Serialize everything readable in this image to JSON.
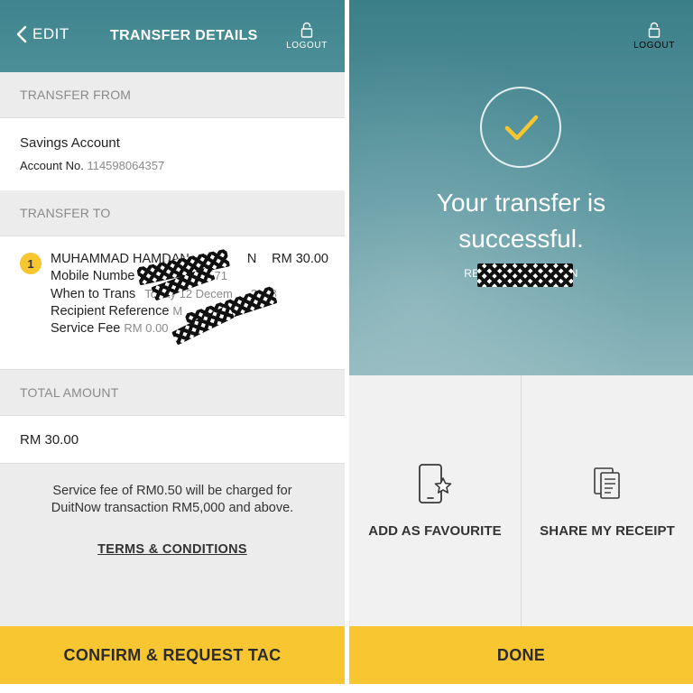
{
  "left": {
    "header": {
      "back_label": "EDIT",
      "title": "TRANSFER DETAILS",
      "logout_label": "LOGOUT"
    },
    "transfer_from": {
      "section_label": "TRANSFER FROM",
      "account_name": "Savings Account",
      "account_no_label": "Account No.",
      "account_no_value": "114598064357"
    },
    "transfer_to": {
      "section_label": "TRANSFER TO",
      "badge": "1",
      "recipient_name": "MUHAMMAD HAMDAN",
      "recipient_name_tail": "N",
      "amount": "RM 30.00",
      "mobile_label": "Mobile Numbe",
      "mobile_tail": "71",
      "when_label": "When to Trans",
      "when_value": "Today 12 Decem",
      "when_tail": "2018",
      "reference_label": "Recipient Reference",
      "reference_value": "M",
      "fee_label": "Service Fee",
      "fee_value": "RM 0.00"
    },
    "total": {
      "section_label": "TOTAL AMOUNT",
      "value": "RM 30.00"
    },
    "note_line1": "Service fee of RM0.50 will be charged for",
    "note_line2": "DuitNow transaction RM5,000 and above.",
    "terms_label": "TERMS & CONDITIONS",
    "cta_label": "CONFIRM & REQUEST TAC"
  },
  "right": {
    "logout_label": "LOGOUT",
    "success_line1": "Your transfer is",
    "success_line2": "successful.",
    "ref_prefix": "RE",
    "ref_suffix": "N",
    "actions": [
      {
        "label": "ADD AS FAVOURITE",
        "icon": "phone-star-icon"
      },
      {
        "label": "SHARE MY RECEIPT",
        "icon": "receipt-icon"
      }
    ],
    "done_label": "DONE"
  },
  "colors": {
    "header_teal": "#3f848e",
    "accent_yellow": "#f8c630",
    "check_yellow": "#f8c630",
    "muted_text": "#8a8a8a"
  }
}
